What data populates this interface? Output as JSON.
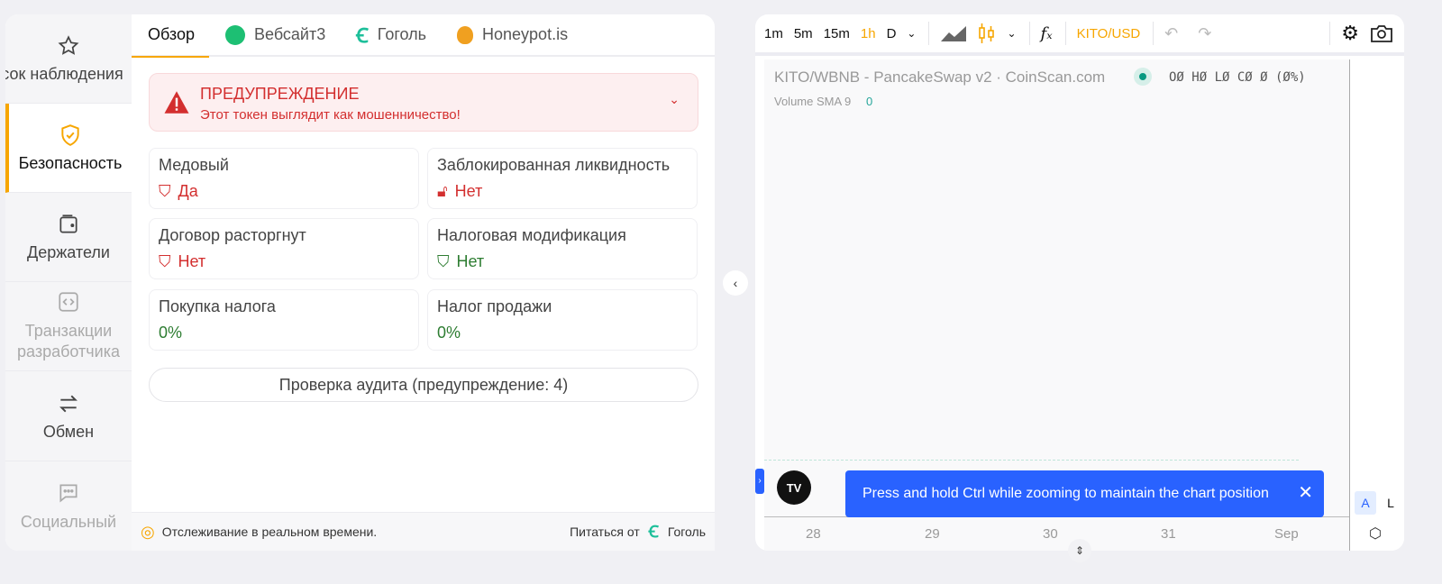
{
  "sidebar": {
    "items": [
      {
        "label": "сок наблюдения",
        "icon": "star-icon"
      },
      {
        "label": "Безопасность",
        "icon": "shield-check-icon",
        "active": true
      },
      {
        "label": "Держатели",
        "icon": "wallet-icon"
      },
      {
        "label": "Транзакции разработчика",
        "icon": "code-icon"
      },
      {
        "label": "Обмен",
        "icon": "swap-icon"
      },
      {
        "label": "Социальный",
        "icon": "chat-icon"
      }
    ]
  },
  "tabs": [
    {
      "label": "Обзор"
    },
    {
      "label": "Вебсайт3"
    },
    {
      "label": "Гоголь"
    },
    {
      "label": "Honeypot.is"
    }
  ],
  "warning": {
    "title": "ПРЕДУПРЕЖДЕНИЕ",
    "message": "Этот токен выглядит как мошенничество!"
  },
  "checks": [
    {
      "label": "Медовый",
      "value": "Да",
      "status": "bad"
    },
    {
      "label": "Заблокированная ликвидность",
      "value": "Нет",
      "status": "bad"
    },
    {
      "label": "Договор расторгнут",
      "value": "Нет",
      "status": "bad"
    },
    {
      "label": "Налоговая модификация",
      "value": "Нет",
      "status": "good"
    },
    {
      "label": "Покупка налога",
      "value": "0%",
      "status": "good"
    },
    {
      "label": "Налог продажи",
      "value": "0%",
      "status": "good"
    }
  ],
  "audit_button": "Проверка аудита (предупреждение: 4)",
  "footer": {
    "realtime": "Отслеживание в реальном времени.",
    "powered_by": "Питаться от",
    "brand": "Гоголь"
  },
  "chart": {
    "intervals": [
      "1m",
      "5m",
      "15m",
      "1h",
      "D"
    ],
    "active_interval": "1h",
    "pair_button": "KITO/USD",
    "title": "KITO/WBNB - PancakeSwap v2 · CoinScan.com",
    "ohlc": "OØ HØ LØ CØ Ø (Ø%)",
    "volume_label": "Volume SMA 9",
    "volume_value": "0",
    "time_ticks": [
      "28",
      "29",
      "30",
      "31",
      "Sep"
    ],
    "scale_a": "A",
    "scale_l": "L",
    "toast": "Press and hold Ctrl while zooming to maintain the chart position"
  },
  "colors": {
    "accent": "#f7a600",
    "red": "#d32f2f",
    "green": "#2e7d32",
    "toast": "#2962ff"
  }
}
